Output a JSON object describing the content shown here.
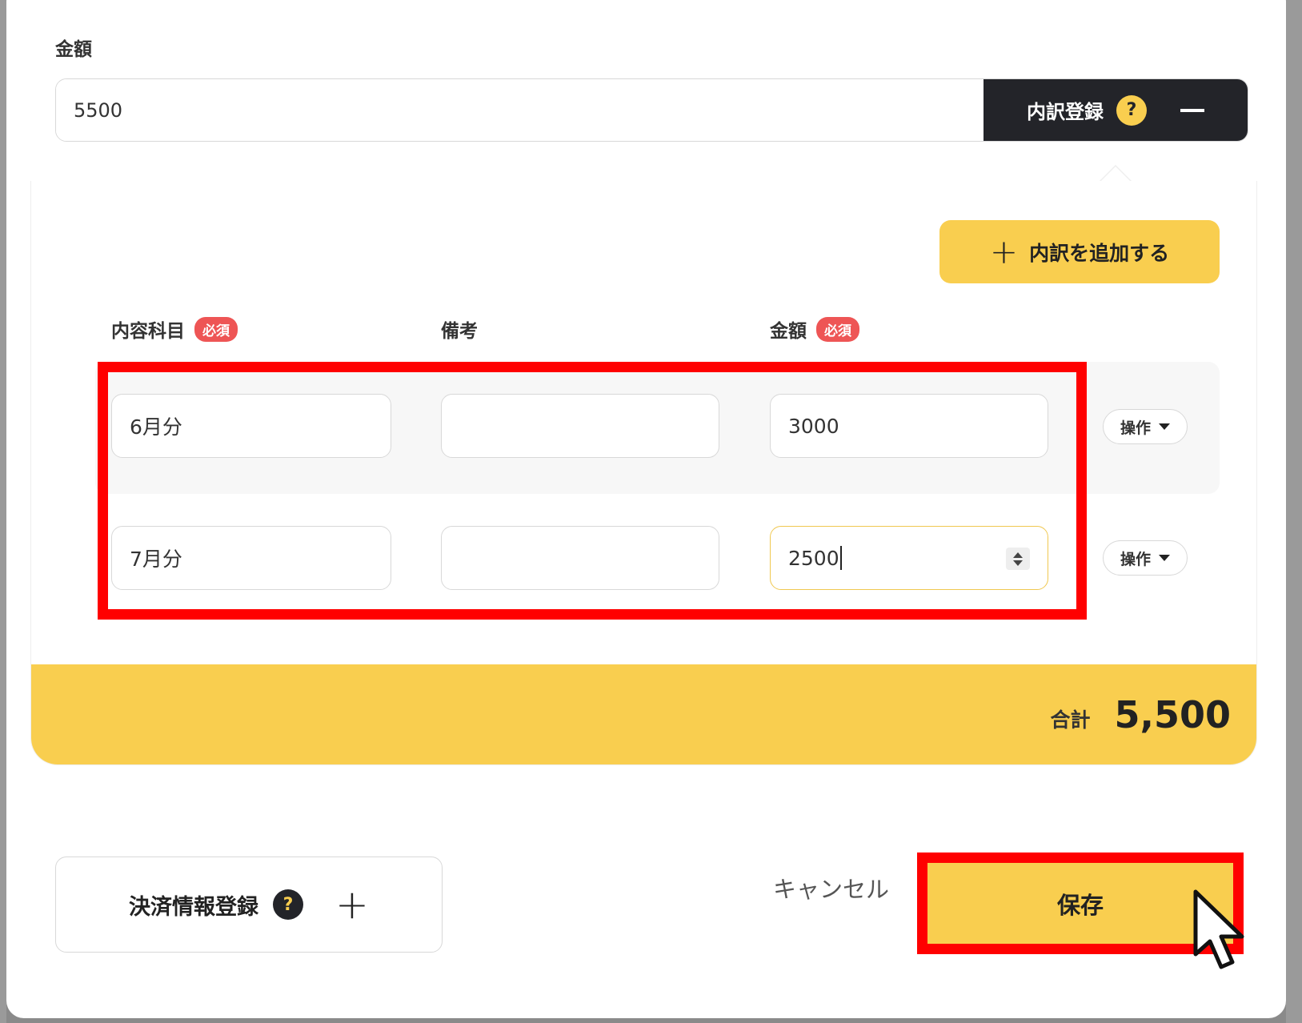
{
  "amount": {
    "label": "金額",
    "value": "5500",
    "breakdown_toggle_label": "内訳登録",
    "help_glyph": "?"
  },
  "breakdown": {
    "add_button_label": "内訳を追加する",
    "add_icon": "plus-icon",
    "columns": {
      "item": "内容科目",
      "note": "備考",
      "amount": "金額",
      "required_badge": "必須"
    },
    "rows": [
      {
        "item": "6月分",
        "note": "",
        "amount": "3000",
        "op_label": "操作"
      },
      {
        "item": "7月分",
        "note": "",
        "amount": "2500",
        "op_label": "操作"
      }
    ],
    "total_label": "合計",
    "total_value": "5,500"
  },
  "footer": {
    "payment_label": "決済情報登録",
    "help_glyph": "?",
    "cancel_label": "キャンセル",
    "save_label": "保存"
  },
  "colors": {
    "accent": "#f9ce4f",
    "dark": "#232429",
    "required": "#ee5555",
    "highlight": "#ff0000"
  }
}
